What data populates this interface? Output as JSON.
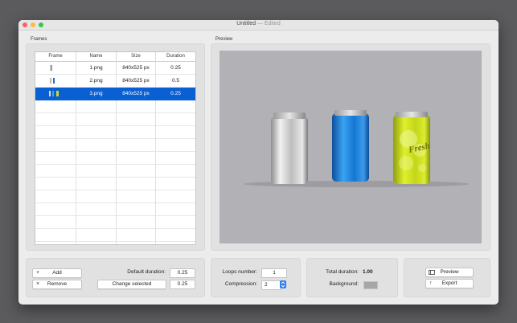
{
  "window": {
    "title": "Untitled",
    "title_suffix": " — Edited"
  },
  "frames": {
    "label": "Frames",
    "columns": [
      "Frame",
      "Name",
      "Size",
      "Duration"
    ],
    "rows": [
      {
        "name": "1.png",
        "size": "840x525 px",
        "duration": "0.25",
        "selected": false
      },
      {
        "name": "2.png",
        "size": "840x525 px",
        "duration": "0.5",
        "selected": false
      },
      {
        "name": "3.png",
        "size": "840x525 px",
        "duration": "0.25",
        "selected": true
      }
    ]
  },
  "preview": {
    "label": "Preview",
    "can_text": "Fresh"
  },
  "controls": {
    "add_label": "Add",
    "remove_label": "Remove",
    "default_duration_label": "Default duration:",
    "default_duration_value": "0.25",
    "change_selected_label": "Change selected",
    "change_selected_value": "0.25",
    "loops_label": "Loops number:",
    "loops_value": "1",
    "compression_label": "Compression:",
    "compression_value": "2",
    "total_duration_label": "Total duration:",
    "total_duration_value": "1.00",
    "background_label": "Background:",
    "preview_button": "Preview",
    "export_button": "Export"
  },
  "colors": {
    "selection": "#0a5fd3",
    "accent": "#2e7cf6",
    "background_swatch": "#a6a6a6"
  }
}
